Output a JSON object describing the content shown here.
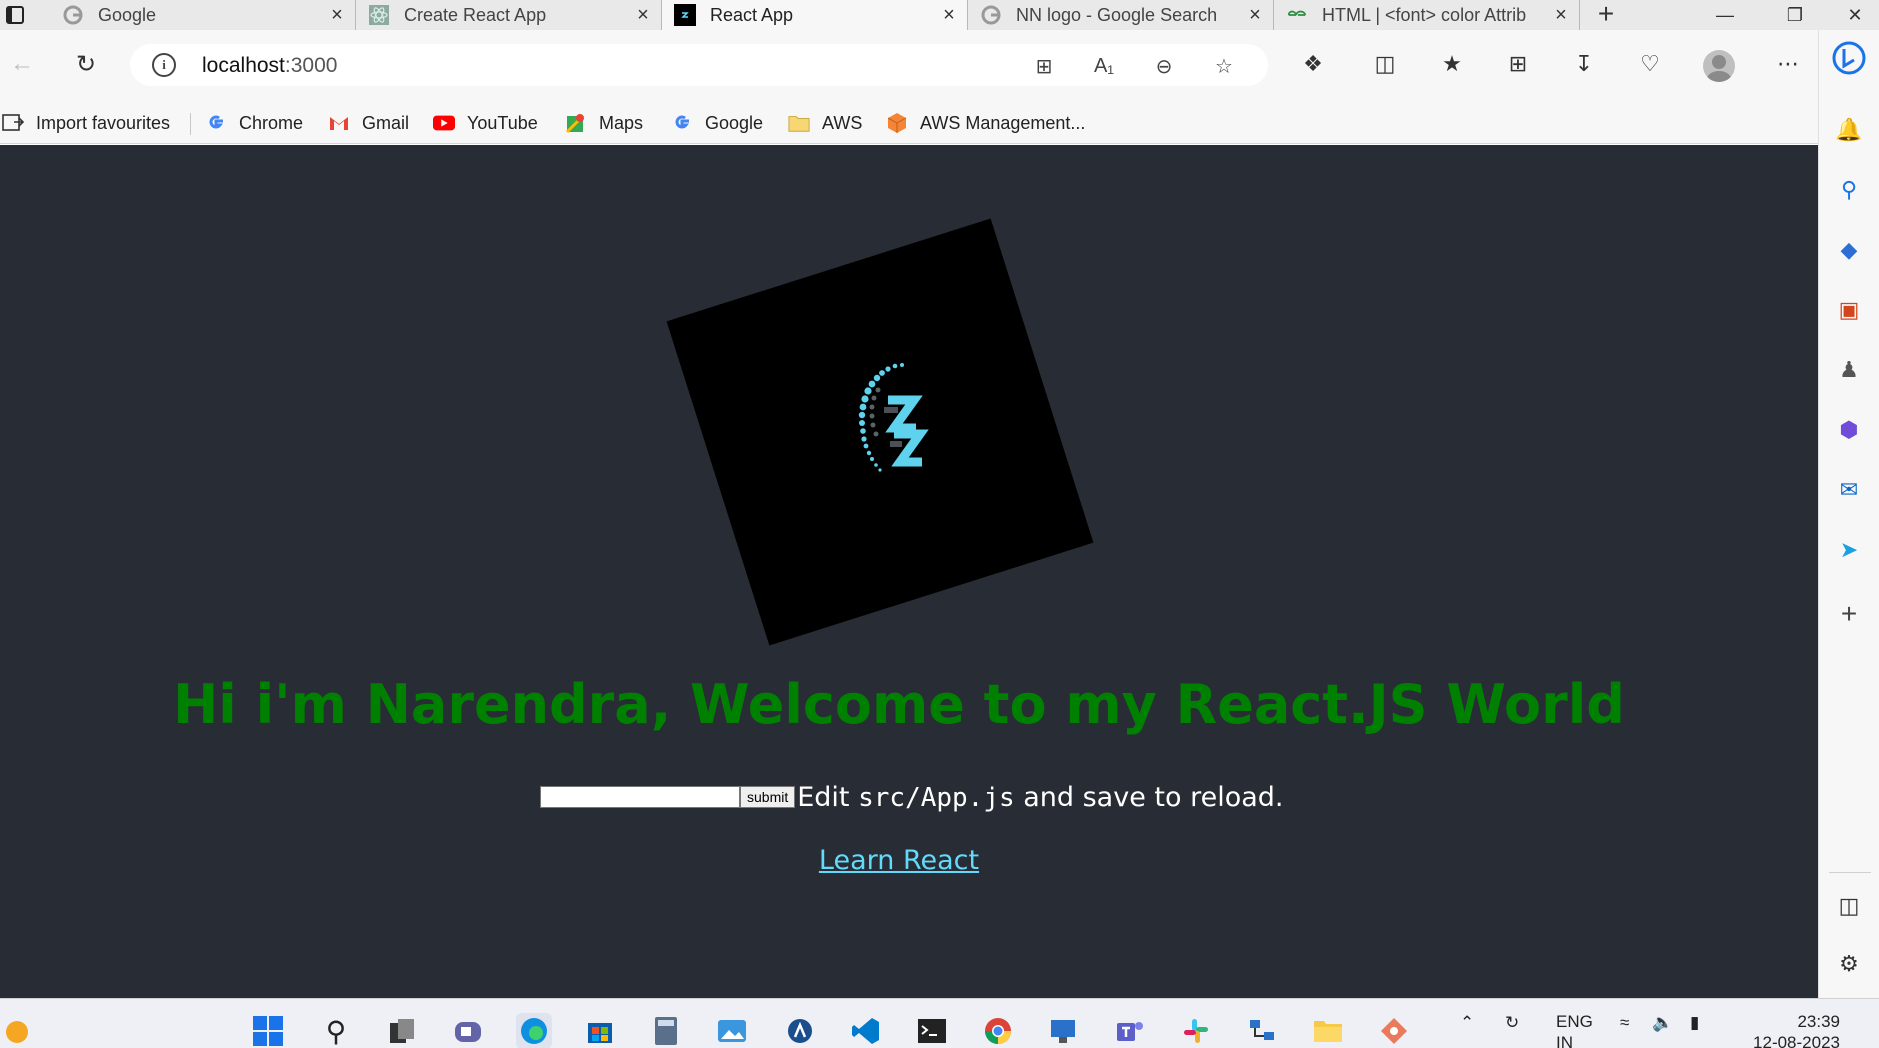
{
  "browser": {
    "tabs": [
      {
        "title": "Google",
        "favicon": "google-icon",
        "active": false
      },
      {
        "title": "Create React App",
        "favicon": "react-icon",
        "active": false
      },
      {
        "title": "React App",
        "favicon": "nn-logo-icon",
        "active": true
      },
      {
        "title": "NN logo - Google Search",
        "favicon": "google-icon",
        "active": false
      },
      {
        "title": "HTML | <font> color Attrib",
        "favicon": "geeksforgeeks-icon",
        "active": false
      }
    ],
    "close_glyph": "×",
    "address": {
      "host": "localhost",
      "port": ":3000"
    }
  },
  "favourites": [
    {
      "label": "Import favourites",
      "icon": "import-icon"
    },
    {
      "label": "Chrome",
      "icon": "google-icon"
    },
    {
      "label": "Gmail",
      "icon": "gmail-icon"
    },
    {
      "label": "YouTube",
      "icon": "youtube-icon"
    },
    {
      "label": "Maps",
      "icon": "maps-icon"
    },
    {
      "label": "Google",
      "icon": "google-icon"
    },
    {
      "label": "AWS",
      "icon": "folder-icon"
    },
    {
      "label": "AWS Management...",
      "icon": "aws-icon"
    }
  ],
  "page": {
    "headline": "Hi i'm Narendra, Welcome to my React.JS World",
    "input_value": "",
    "submit_label": "submit",
    "edit_prefix": "Edit ",
    "edit_code": "src/App.js",
    "edit_suffix": " and save to reload.",
    "link_label": "Learn React",
    "colors": {
      "background": "#282c34",
      "headline": "#008000",
      "link": "#61dafb"
    }
  },
  "taskbar": {
    "language": "ENG",
    "region": "IN",
    "time": "23:39",
    "date": "12-08-2023"
  }
}
